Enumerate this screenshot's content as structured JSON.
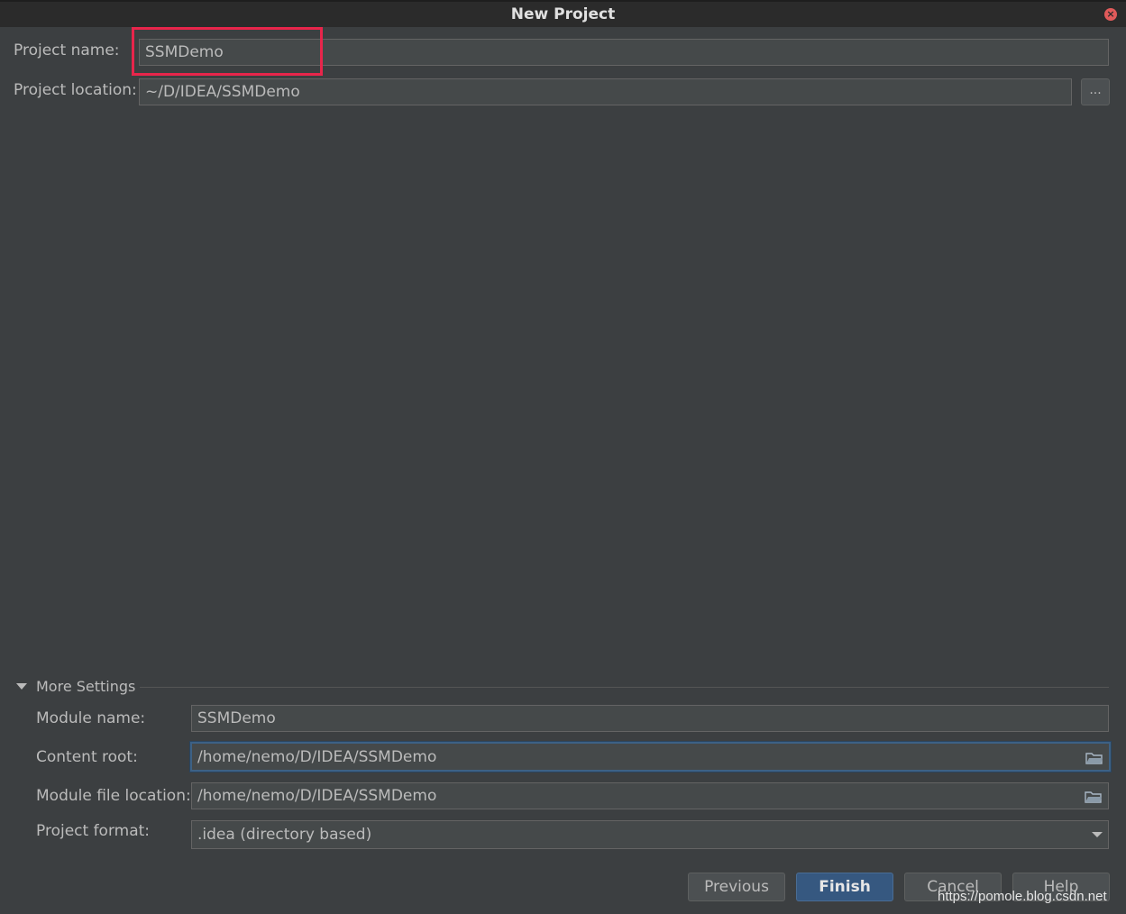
{
  "window": {
    "title": "New Project"
  },
  "project": {
    "name_label": "Project name:",
    "name_value": "SSMDemo",
    "location_label": "Project location:",
    "location_value": "~/D/IDEA/SSMDemo",
    "browse_label": "..."
  },
  "more_settings": {
    "header": "More Settings",
    "module_name_label": "Module name:",
    "module_name_value": "SSMDemo",
    "content_root_label": "Content root:",
    "content_root_value": "/home/nemo/D/IDEA/SSMDemo",
    "module_file_label": "Module file location:",
    "module_file_value": "/home/nemo/D/IDEA/SSMDemo",
    "format_label": "Project format:",
    "format_value": ".idea (directory based)"
  },
  "buttons": {
    "previous": "Previous",
    "finish": "Finish",
    "cancel": "Cancel",
    "help": "Help"
  },
  "watermark": "https://pomole.blog.csdn.net",
  "colors": {
    "background": "#3c3f41",
    "highlight": "#e8254b",
    "primary_button": "#365880",
    "focus_border": "#3d6185"
  }
}
